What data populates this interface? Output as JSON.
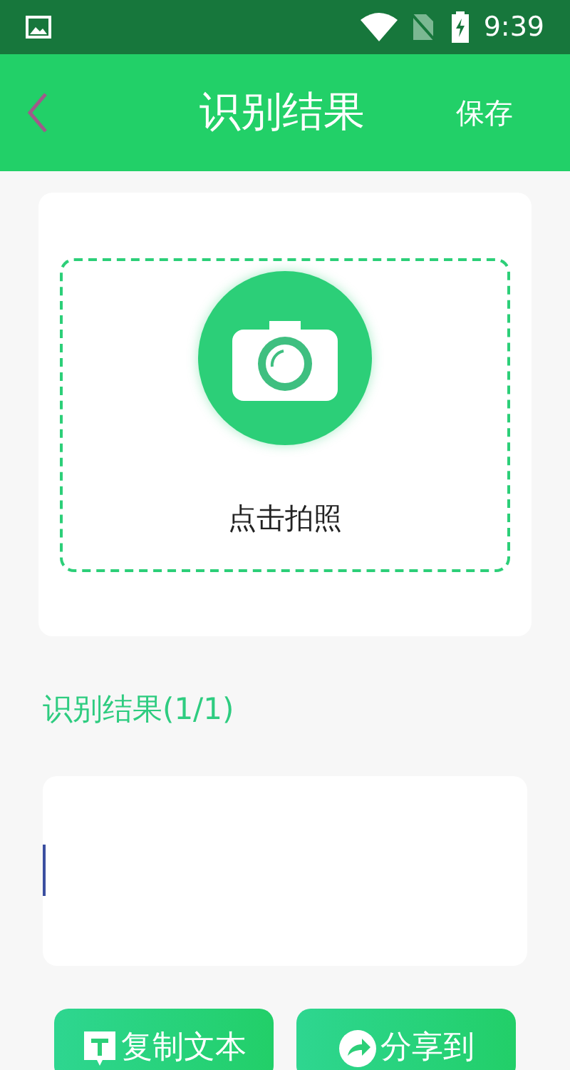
{
  "status_bar": {
    "time": "9:39"
  },
  "header": {
    "title": "识别结果",
    "action": "保存"
  },
  "capture": {
    "label": "点击拍照"
  },
  "result": {
    "heading": "识别结果(1/1)"
  },
  "buttons": [
    {
      "kind": "copy",
      "label": "复制文本"
    },
    {
      "kind": "share",
      "label": "分享到"
    }
  ]
}
